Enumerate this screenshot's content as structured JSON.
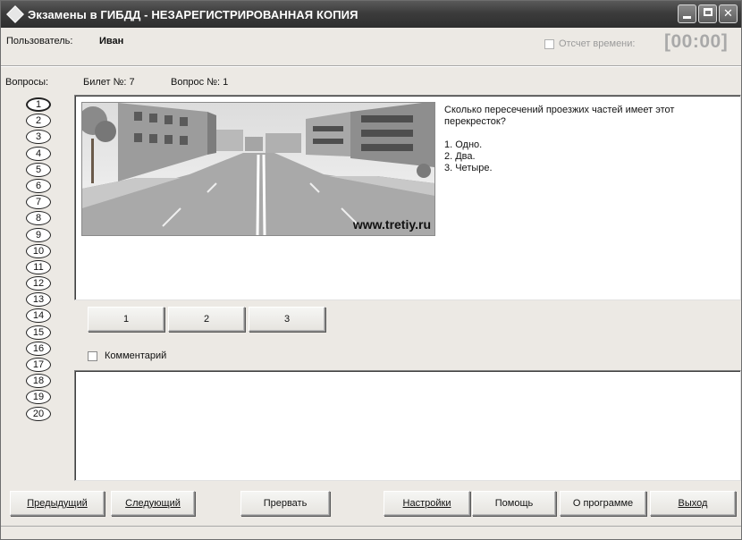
{
  "window": {
    "title": "Экзамены в ГИБДД - НЕЗАРЕГИСТРИРОВАННАЯ КОПИЯ",
    "min_symbol": "",
    "max_symbol": "",
    "close_symbol": "✕"
  },
  "user": {
    "label": "Пользователь:",
    "name": "Иван"
  },
  "timer": {
    "checkbox_label": "Отсчет времени:",
    "checked": false,
    "enabled": false,
    "value": "[00:00]"
  },
  "questions": {
    "label": "Вопросы:",
    "numbers": [
      "1",
      "2",
      "3",
      "4",
      "5",
      "6",
      "7",
      "8",
      "9",
      "10",
      "11",
      "12",
      "13",
      "14",
      "15",
      "16",
      "17",
      "18",
      "19",
      "20"
    ],
    "active": "1"
  },
  "ticket": {
    "ticket_label": "Билет №: 7",
    "question_label": "Вопрос №: 1"
  },
  "question": {
    "text": "Сколько пересечений проезжих частей имеет этот перекресток?",
    "options": [
      "1. Одно.",
      "2. Два.",
      "3. Четыре."
    ],
    "image_watermark": "www.tretiy.ru"
  },
  "answers": [
    "1",
    "2",
    "3"
  ],
  "comment": {
    "label": "Комментарий",
    "checked": false
  },
  "buttons": {
    "prev": "Предыдущий",
    "next": "Следующий",
    "abort": "Прервать",
    "settings": "Настройки",
    "help": "Помощь",
    "about": "О программе",
    "exit": "Выход"
  },
  "colors": {
    "titlebar": "#3c3c3c",
    "window_bg": "#ece9e4"
  }
}
